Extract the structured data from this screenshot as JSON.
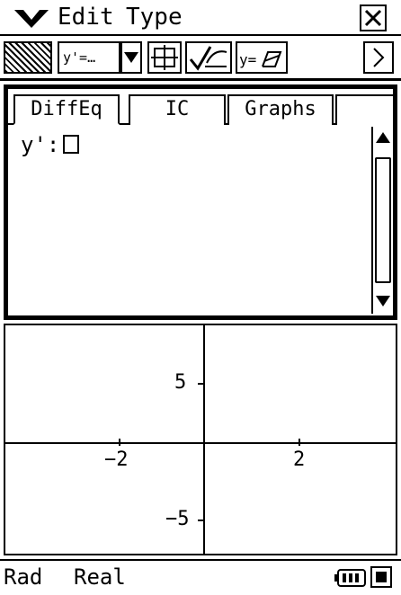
{
  "menu": {
    "items": [
      "Edit",
      "Type"
    ],
    "close_label": "×"
  },
  "toolbar": {
    "combo_value": "y'=…",
    "scroll_right": "▶"
  },
  "tabs": [
    {
      "label": "DiffEq",
      "selected": true
    },
    {
      "label": "IC",
      "selected": false
    },
    {
      "label": "Graphs",
      "selected": false
    }
  ],
  "editor": {
    "equation_label": "y':"
  },
  "graph": {
    "x_ticks": [
      "−2",
      "2"
    ],
    "y_ticks": [
      "5",
      "−5"
    ]
  },
  "status": {
    "angle_mode": "Rad",
    "number_mode": "Real"
  }
}
